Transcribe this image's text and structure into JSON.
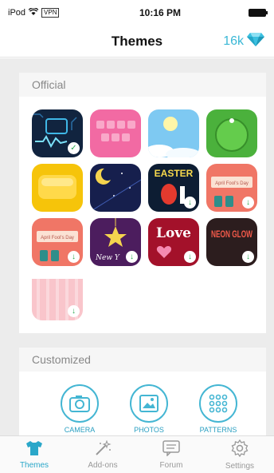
{
  "status": {
    "carrier": "iPod",
    "vpn": "VPN",
    "time": "10:16 PM"
  },
  "nav": {
    "title": "Themes",
    "coins": "16k",
    "coin_icon": "diamond-icon"
  },
  "official": {
    "header": "Official",
    "tiles": [
      {
        "name": "tile-circuit-blue",
        "bg": "#11243f",
        "badge": "check",
        "text": ""
      },
      {
        "name": "tile-pink-keys",
        "bg": "#f26aa3",
        "badge": "",
        "text": ""
      },
      {
        "name": "tile-sky-clouds",
        "bg": "#7ec9f2",
        "badge": "",
        "text": ""
      },
      {
        "name": "tile-green-button",
        "bg": "#4bb13c",
        "badge": "",
        "text": ""
      },
      {
        "name": "tile-yellow-jelly",
        "bg": "#f6c40a",
        "badge": "",
        "text": ""
      },
      {
        "name": "tile-night-moon",
        "bg": "#161f4d",
        "badge": "",
        "text": ""
      },
      {
        "name": "tile-easter",
        "bg": "#0d1d33",
        "badge": "download",
        "text": "EASTER"
      },
      {
        "name": "tile-april-fools-1",
        "bg": "#f07666",
        "badge": "download",
        "text": "April Fool's Day"
      },
      {
        "name": "tile-april-fools-2",
        "bg": "#f07666",
        "badge": "download",
        "text": "April Fool's Day"
      },
      {
        "name": "tile-new-year",
        "bg": "#4c1d5e",
        "badge": "download",
        "text": "New Y"
      },
      {
        "name": "tile-love",
        "bg": "#a3112a",
        "badge": "download",
        "text": "Love"
      },
      {
        "name": "tile-neon-glow",
        "bg": "#2c1d1e",
        "badge": "download",
        "text": "NEON GLOW"
      },
      {
        "name": "tile-pink-stripes",
        "bg": "#f9c5cb",
        "badge": "download",
        "text": ""
      }
    ]
  },
  "customized": {
    "header": "Customized",
    "buttons": [
      {
        "name": "camera-button",
        "icon": "camera-icon",
        "label": "CAMERA"
      },
      {
        "name": "photos-button",
        "icon": "photos-icon",
        "label": "PHOTOS"
      },
      {
        "name": "patterns-button",
        "icon": "patterns-icon",
        "label": "PATTERNS"
      }
    ]
  },
  "tabs": [
    {
      "name": "tab-themes",
      "icon": "tshirt-icon",
      "label": "Themes",
      "active": true
    },
    {
      "name": "tab-addons",
      "icon": "magic-wand-icon",
      "label": "Add-ons",
      "active": false
    },
    {
      "name": "tab-forum",
      "icon": "forum-icon",
      "label": "Forum",
      "active": false
    },
    {
      "name": "tab-settings",
      "icon": "gear-icon",
      "label": "Settings",
      "active": false
    }
  ],
  "colors": {
    "accent": "#2aa7c9",
    "page_bg": "#ececec"
  }
}
